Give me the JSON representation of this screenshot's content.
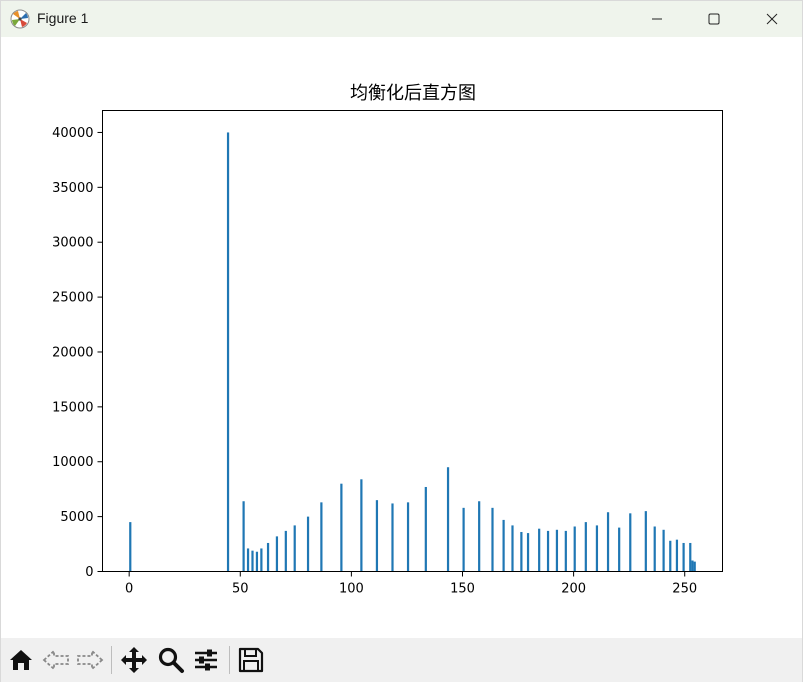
{
  "window": {
    "title": "Figure 1"
  },
  "icons": {
    "app": "matplotlib-icon",
    "minimize": "minimize-icon",
    "maximize": "maximize-icon",
    "close": "close-icon"
  },
  "toolbar": {
    "tools": [
      "home-icon",
      "back-icon",
      "forward-icon",
      "pan-icon",
      "zoom-icon",
      "configure-subplots-icon",
      "save-icon"
    ]
  },
  "colors": {
    "bar": "#1f77b4",
    "titlebar": "#eff4ec",
    "toolbar": "#f0f0f0"
  },
  "chart_data": {
    "type": "bar",
    "title": "均衡化后直方图",
    "xlabel": "",
    "ylabel": "",
    "xlim": [
      -12,
      267
    ],
    "ylim": [
      0,
      42000
    ],
    "xticks": [
      0,
      50,
      100,
      150,
      200,
      250
    ],
    "yticks": [
      0,
      5000,
      10000,
      15000,
      20000,
      25000,
      30000,
      35000,
      40000
    ],
    "grid": false,
    "legend": "none",
    "bins": 256,
    "x": [
      0,
      44,
      51,
      53,
      55,
      57,
      59,
      62,
      66,
      70,
      74,
      80,
      86,
      95,
      104,
      111,
      118,
      125,
      133,
      143,
      150,
      157,
      163,
      168,
      172,
      176,
      179,
      184,
      188,
      192,
      196,
      200,
      205,
      210,
      215,
      220,
      225,
      232,
      236,
      240,
      243,
      246,
      249,
      252,
      253,
      254
    ],
    "values": [
      4500,
      40000,
      6400,
      2100,
      1900,
      1800,
      2100,
      2600,
      3200,
      3700,
      4200,
      5000,
      6300,
      8000,
      8400,
      6500,
      6200,
      6300,
      7700,
      9500,
      5800,
      6400,
      5800,
      4700,
      4200,
      3600,
      3500,
      3900,
      3700,
      3800,
      3700,
      4100,
      4500,
      4200,
      5400,
      4000,
      5300,
      5500,
      4100,
      3800,
      2800,
      2900,
      2600,
      2600,
      1000,
      900
    ]
  }
}
